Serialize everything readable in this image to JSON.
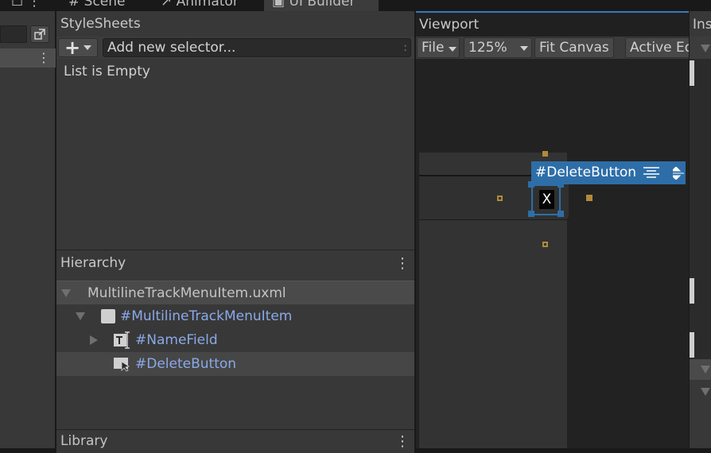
{
  "tabs": [
    {
      "label": "# Scene"
    },
    {
      "label": "Animator"
    },
    {
      "label": "UI Builder"
    }
  ],
  "stylesheets": {
    "title": "StyleSheets",
    "add_button": "+",
    "selector_placeholder": "Add new selector...",
    "options_dots": ":",
    "empty_text": "List is Empty"
  },
  "hierarchy": {
    "title": "Hierarchy",
    "file": "MultilineTrackMenuItem.uxml",
    "items": [
      {
        "label": "#MultilineTrackMenuItem"
      },
      {
        "label": "#NameField"
      },
      {
        "label": "#DeleteButton"
      }
    ]
  },
  "library": {
    "title": "Library"
  },
  "viewport": {
    "title": "Viewport",
    "file_menu": "File",
    "zoom": "125%",
    "fit_canvas": "Fit Canvas",
    "active_editor": "Active Ed",
    "selected_label": "#DeleteButton",
    "button_text": "X"
  },
  "inspector": {
    "title": "Ins"
  },
  "colors": {
    "accent": "#3a79bb",
    "selection": "#2e6ea8",
    "link": "#8aa9e8",
    "handle_gold": "#b08a3a"
  },
  "icons": [
    "tab-scene-icon",
    "animator-icon",
    "ui-builder-icon",
    "kebab-menu-icon",
    "plus-icon",
    "chevron-down-icon",
    "foldout-arrow-icon",
    "visual-element-icon",
    "text-field-icon",
    "button-icon",
    "align-icon"
  ]
}
